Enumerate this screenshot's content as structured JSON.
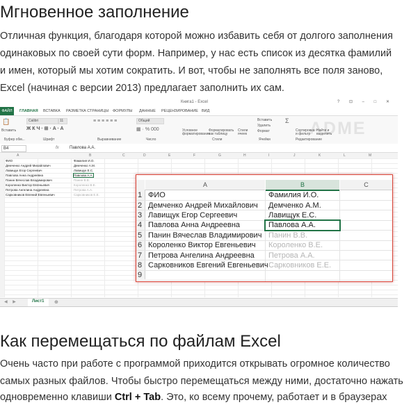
{
  "section1": {
    "heading": "Мгновенное заполнение",
    "paragraph_lines": [
      "Отличная функция, благодаря которой можно избавить себя от долгого заполнения",
      "одинаковых по своей сути форм. Например, у нас есть список из десятка фамилий",
      "и имен, который мы хотим сократить. И вот, чтобы не заполнять все поля заново,",
      "Excel (начиная с версии 2013) предлагает заполнить их сам."
    ]
  },
  "excel": {
    "window_title": "Книга1 - Excel",
    "window_controls": "? ⊡ – □ ✕",
    "tabs": [
      "ФАЙЛ",
      "ГЛАВНАЯ",
      "ВСТАВКА",
      "РАЗМЕТКА СТРАНИЦЫ",
      "ФОРМУЛЫ",
      "ДАННЫЕ",
      "РЕЦЕНЗИРОВАНИЕ",
      "ВИД"
    ],
    "ribbon_groups": [
      "Буфер обм...",
      "Шрифт",
      "Выравнивание",
      "Число",
      "Стили",
      "Ячейки",
      "Редактирование"
    ],
    "ribbon_labels": {
      "paste": "Вставить",
      "font_name": "Calibri",
      "font_size": "11",
      "number_format": "Общий",
      "cond_format": "Условное форматирование",
      "format_table": "Форматировать как таблицу",
      "cell_styles": "Стили ячеек",
      "insert": "Вставить",
      "delete": "Удалить",
      "format": "Формат",
      "sort": "Сортировка и фильтр",
      "find": "Найти и выделить"
    },
    "watermark": "ADME",
    "name_box": "B4",
    "fx": "fx",
    "formula_value": "Павлова А.А.",
    "columns": [
      "A",
      "B",
      "C",
      "D",
      "E",
      "F",
      "G",
      "H",
      "I",
      "J",
      "K",
      "L",
      "M"
    ],
    "sheet_tab": "Лист1",
    "add_sheet": "⊕",
    "sheet_nav": "◀ ▶"
  },
  "table": {
    "col_a": "A",
    "col_b": "B",
    "col_c": "C",
    "header_a": "ФИО",
    "header_b": "Фамилия И.О.",
    "rows": [
      {
        "n": "1",
        "a": "ФИО",
        "b": "Фамилия И.О.",
        "state": "typed"
      },
      {
        "n": "2",
        "a": "Демченко Андрей Михайлович",
        "b": "Демченко А.М.",
        "state": "typed"
      },
      {
        "n": "3",
        "a": "Лавищук Егор Сергеевич",
        "b": "Лавищук Е.С.",
        "state": "typed"
      },
      {
        "n": "4",
        "a": "Павлова Анна Андреевна",
        "b": "Павлова А.А.",
        "state": "selected"
      },
      {
        "n": "5",
        "a": "Панин Вячеслав Владимирович",
        "b": "Панин В.В.",
        "state": "suggested"
      },
      {
        "n": "6",
        "a": "Короленко Виктор Евгеньевич",
        "b": "Короленко В.Е.",
        "state": "suggested"
      },
      {
        "n": "7",
        "a": "Петрова Ангелина Андреевна",
        "b": "Петрова А.А.",
        "state": "suggested"
      },
      {
        "n": "8",
        "a": "Сарковников Евгений Евгеньевич",
        "b": "Сарковников Е.Е.",
        "state": "suggested"
      },
      {
        "n": "9",
        "a": "",
        "b": "",
        "state": "empty"
      }
    ]
  },
  "section2": {
    "heading": "Как перемещаться по файлам Excel",
    "line1": "Очень часто при работе с программой приходится открывать огромное количество",
    "line2": "самых разных файлов. Чтобы быстро перемещаться между ними, достаточно нажать",
    "line3_pre": "одновременно клавиши ",
    "line3_keys": "Ctrl + Tab",
    "line3_post": ". Это, ко всему прочему, работает и в браузерах"
  }
}
